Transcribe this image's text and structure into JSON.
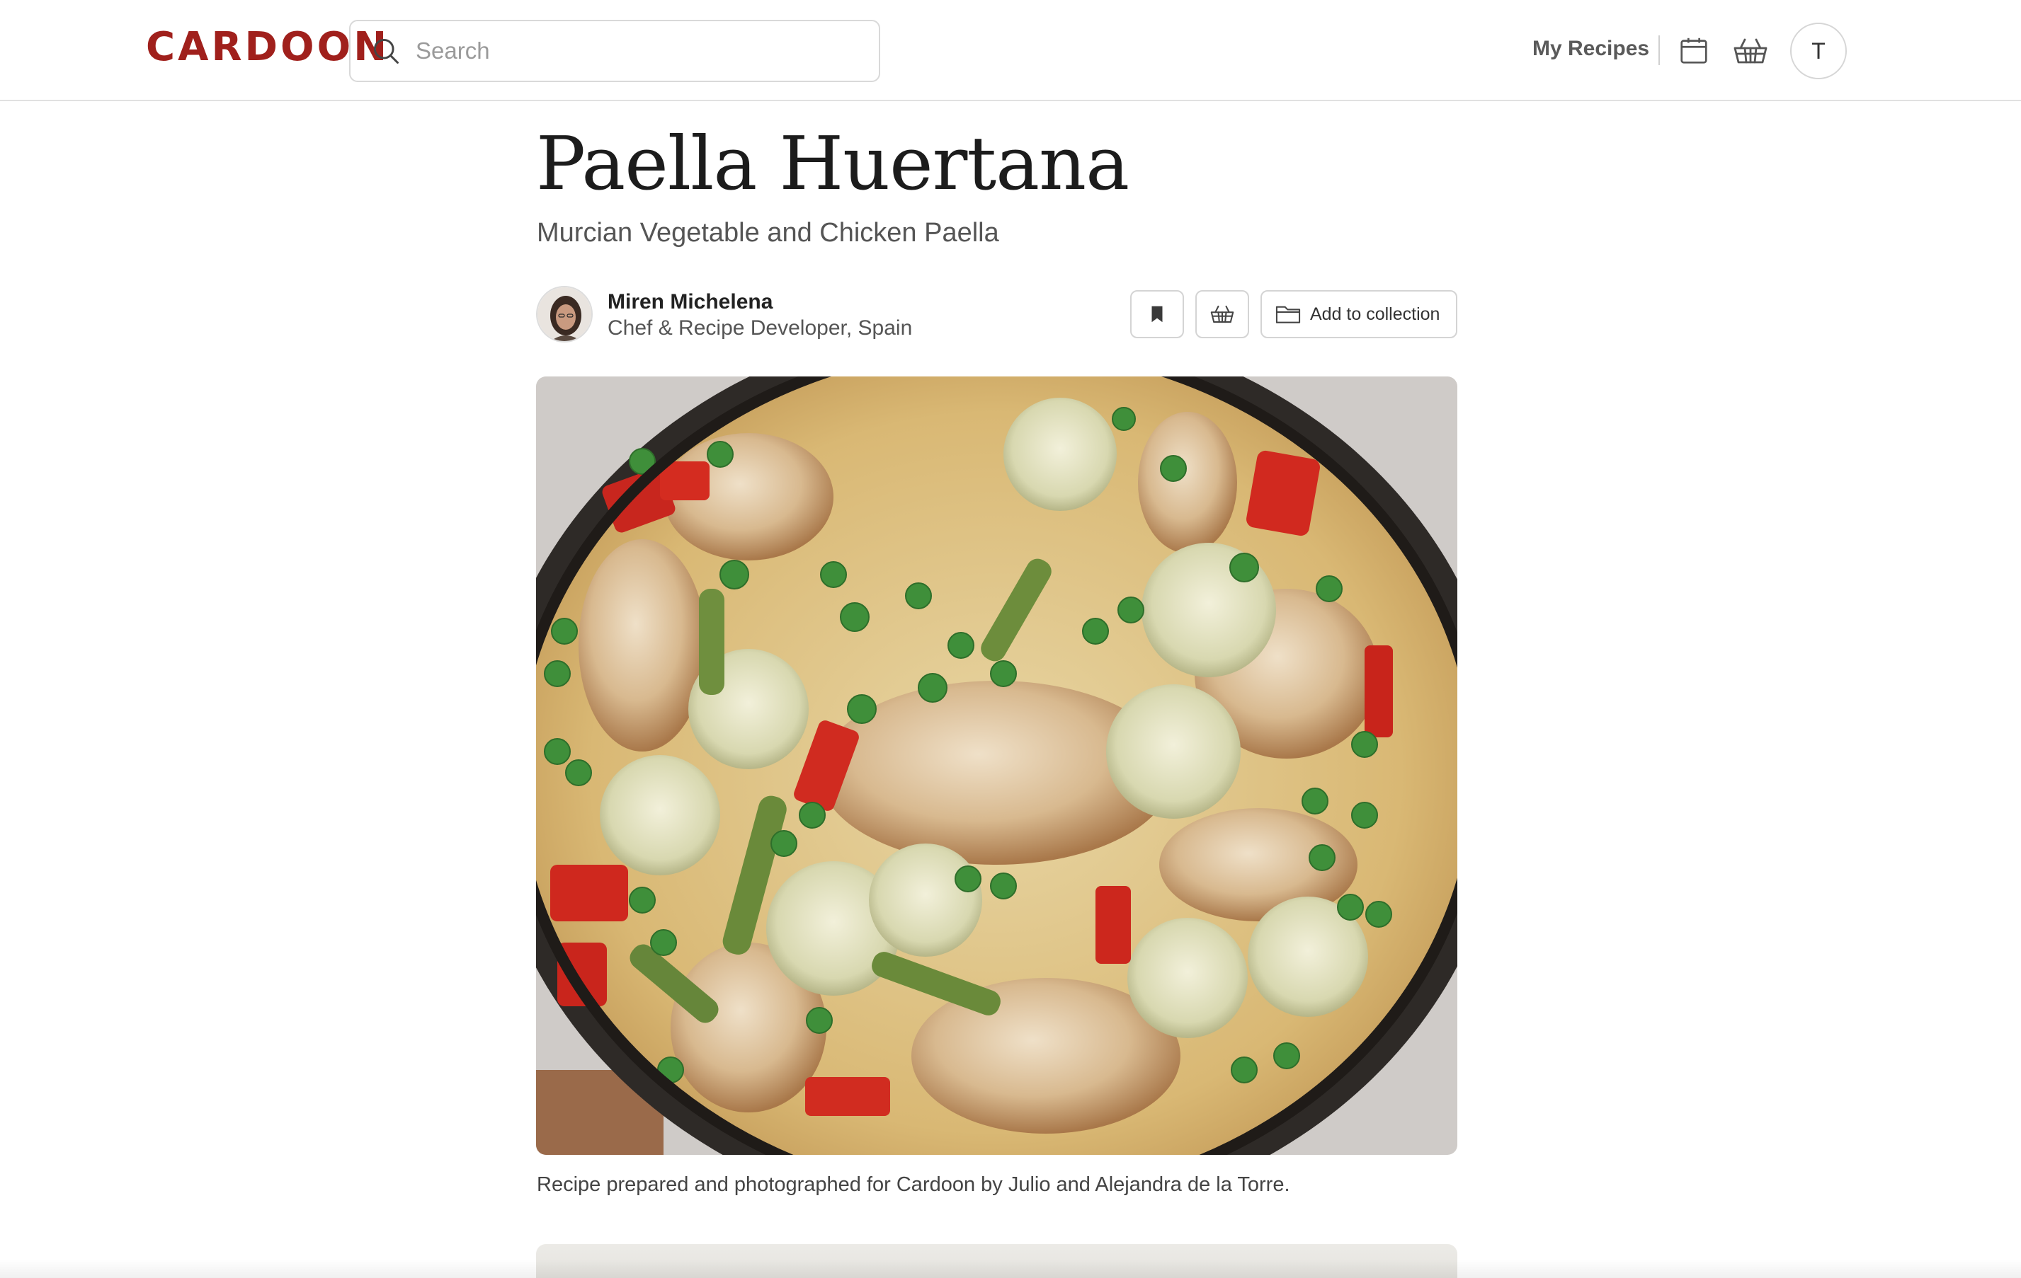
{
  "header": {
    "logo": "CARDOON",
    "search": {
      "placeholder": "Search",
      "value": ""
    },
    "my_recipes_label": "My Recipes",
    "avatar_initial": "T"
  },
  "recipe": {
    "title": "Paella Huertana",
    "subtitle": "Murcian Vegetable and Chicken Paella",
    "author": {
      "name": "Miren Michelena",
      "role": "Chef & Recipe Developer, Spain"
    },
    "actions": {
      "collection_label": "Add to collection"
    },
    "caption": "Recipe prepared and photographed for Cardoon by Julio and Alejandra de la Torre."
  },
  "icons": {
    "search": "search-icon",
    "calendar": "calendar-icon",
    "basket": "basket-icon",
    "bookmark": "bookmark-icon",
    "cart": "basket-icon",
    "folder": "folder-icon"
  },
  "colors": {
    "brand": "#a0201c",
    "text": "#1f1f1f",
    "muted": "#555555",
    "border": "#d6d6d6"
  }
}
